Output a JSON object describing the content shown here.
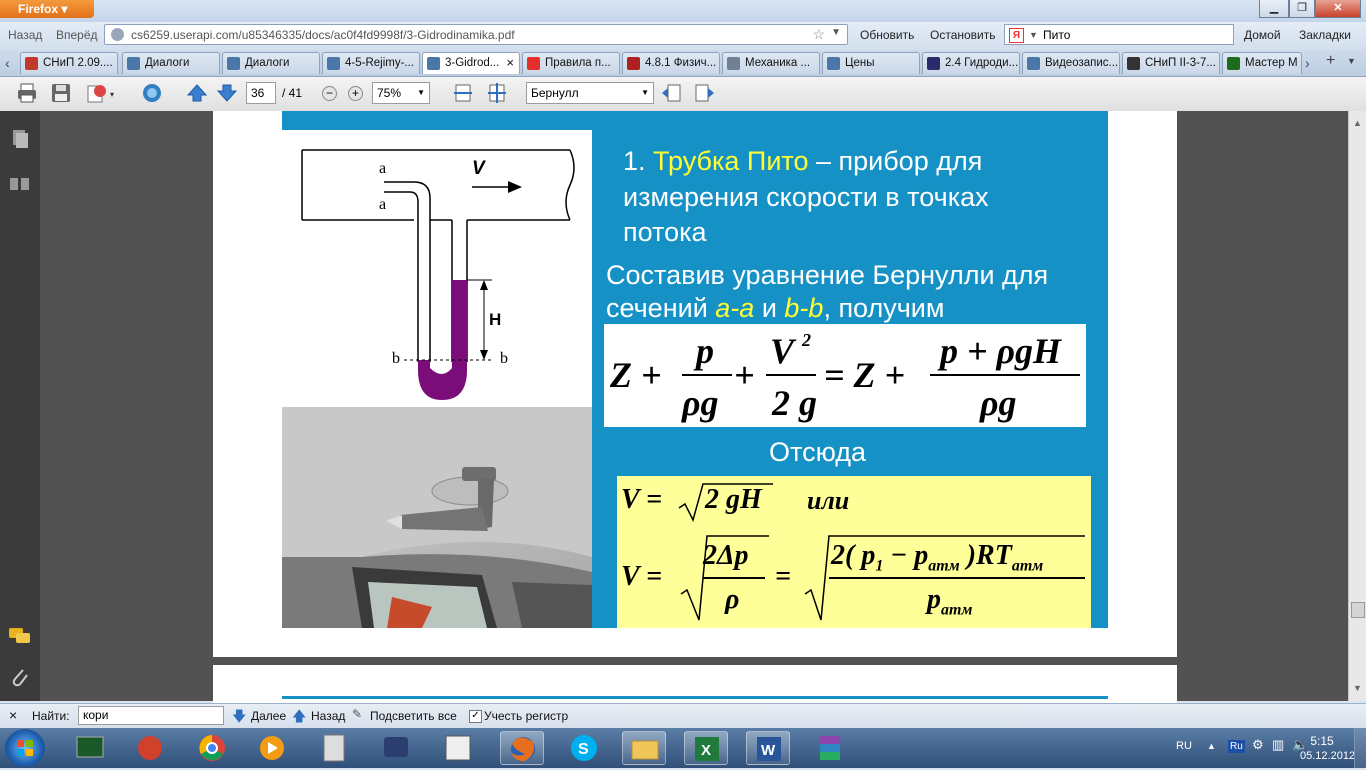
{
  "browser": {
    "app_button": "Firefox",
    "back": "Назад",
    "forward": "Вперёд",
    "url": "cs6259.userapi.com/u85346335/docs/ac0f4fd9998f/3-Gidrodinamika.pdf",
    "reload": "Обновить",
    "stop": "Остановить",
    "search_value": "Пито",
    "home": "Домой",
    "bookmarks": "Закладки",
    "new_tab": "+",
    "tabs": [
      {
        "label": "СНиП 2.09....",
        "icon_color": "#c0392b"
      },
      {
        "label": "Диалоги",
        "icon_color": "#4a76a8"
      },
      {
        "label": "Диалоги",
        "icon_color": "#4a76a8"
      },
      {
        "label": "4-5-Rejimy-...",
        "icon_color": "#4a76a8"
      },
      {
        "label": "3-Gidrod...",
        "icon_color": "#4a76a8"
      },
      {
        "label": "Правила п...",
        "icon_color": "#e52e2e"
      },
      {
        "label": "4.8.1 Физич...",
        "icon_color": "#b02020"
      },
      {
        "label": "Механика ...",
        "icon_color": "#6f7f94"
      },
      {
        "label": "Цены",
        "icon_color": "#4a76a8"
      },
      {
        "label": "2.4 Гидроди...",
        "icon_color": "#2b2b6b"
      },
      {
        "label": "Видеозапис...",
        "icon_color": "#4a76a8"
      },
      {
        "label": "СНиП II-3-7...",
        "icon_color": "#333333"
      },
      {
        "label": "Мастер М",
        "icon_color": "#1e6b1e"
      }
    ]
  },
  "pdf_toolbar": {
    "page_current": "36",
    "page_total": "/ 41",
    "zoom": "75%",
    "search_value": "Бернулл"
  },
  "slide": {
    "heading_number": "1. ",
    "heading_highlight": "Трубка Пито",
    "heading_line1_rest": " – прибор для",
    "heading_line2": "измерения скорости в точках",
    "heading_line3": "потока",
    "text_line1": "Составив уравнение Бернулли для",
    "text_line2_pre": "сечений ",
    "text_aa": "a-a",
    "text_and": " и ",
    "text_bb": "b-b",
    "text_line2_post": ", получим",
    "hence": "Отсюда",
    "diagram_labels": {
      "a_top": "a",
      "a_bottom": "a",
      "v": "V",
      "h": "H",
      "b_left": "b",
      "b_right": "b"
    },
    "eq": {
      "z1": "Z +",
      "f1_num": "p",
      "f1_den": "ρg",
      "plus": "+",
      "f2_num": "V",
      "f2_sup": "2",
      "f2_den": "2 g",
      "eqz": "= Z +",
      "f3_num": "p + ρgH",
      "f3_den": "ρg"
    },
    "v_eq": {
      "line1_lhs": "V =",
      "line1_rad": "2 gH",
      "ili": "или",
      "line2_lhs": "V =",
      "frac1_num": "2Δp",
      "frac1_den": "ρ",
      "eq": "=",
      "frac2_num_a": "2( p",
      "frac2_num_sub1": "1",
      "frac2_num_b": " − p",
      "frac2_num_sub2": "атм",
      "frac2_num_c": " )RT",
      "frac2_num_sub3": "атм",
      "frac2_den": "p",
      "frac2_den_sub": "атм"
    }
  },
  "findbar": {
    "close": "×",
    "label": "Найти:",
    "value": "кори",
    "next": "Далее",
    "prev": "Назад",
    "highlight": "Подсветить все",
    "match_case": "Учесть регистр"
  },
  "taskbar": {
    "lang": "RU",
    "lang_badge": "Ru",
    "time": "5:15",
    "date": "05.12.2012"
  }
}
